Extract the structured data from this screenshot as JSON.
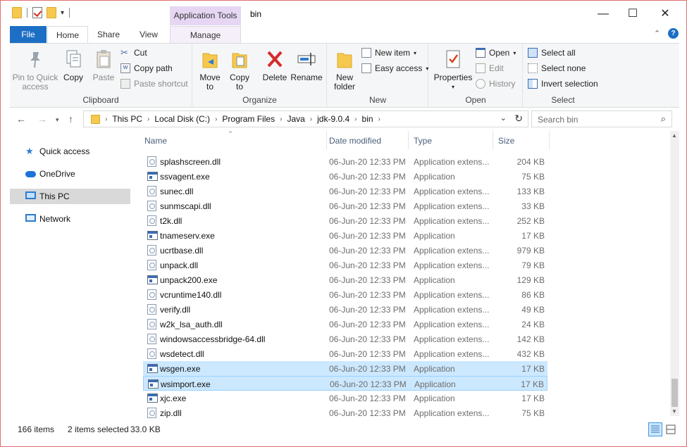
{
  "window": {
    "title": "bin",
    "context_tab_group": "Application Tools",
    "controls": {
      "minimize": "—",
      "maximize": "☐",
      "close": "✕"
    }
  },
  "ribbon_tabs": {
    "file": "File",
    "home": "Home",
    "share": "Share",
    "view": "View",
    "manage": "Manage"
  },
  "ribbon": {
    "clipboard": {
      "label": "Clipboard",
      "pin": "Pin to Quick access",
      "copy": "Copy",
      "paste": "Paste",
      "cut": "Cut",
      "copy_path": "Copy path",
      "paste_shortcut": "Paste shortcut"
    },
    "organize": {
      "label": "Organize",
      "move_to": "Move to",
      "copy_to": "Copy to",
      "delete": "Delete",
      "rename": "Rename"
    },
    "new": {
      "label": "New",
      "new_folder": "New folder",
      "new_item": "New item",
      "easy_access": "Easy access"
    },
    "open": {
      "label": "Open",
      "properties": "Properties",
      "open": "Open",
      "edit": "Edit",
      "history": "History"
    },
    "select": {
      "label": "Select",
      "select_all": "Select all",
      "select_none": "Select none",
      "invert_selection": "Invert selection"
    }
  },
  "address": {
    "crumbs": [
      "This PC",
      "Local Disk (C:)",
      "Program Files",
      "Java",
      "jdk-9.0.4",
      "bin"
    ],
    "search_placeholder": "Search bin"
  },
  "nav": {
    "items": [
      "Quick access",
      "OneDrive",
      "This PC",
      "Network"
    ]
  },
  "columns": {
    "name": "Name",
    "date": "Date modified",
    "type": "Type",
    "size": "Size"
  },
  "files": [
    {
      "name": "splashscreen.dll",
      "date": "06-Jun-20 12:33 PM",
      "type": "Application extens...",
      "size": "204 KB",
      "kind": "dll"
    },
    {
      "name": "ssvagent.exe",
      "date": "06-Jun-20 12:33 PM",
      "type": "Application",
      "size": "75 KB",
      "kind": "exe"
    },
    {
      "name": "sunec.dll",
      "date": "06-Jun-20 12:33 PM",
      "type": "Application extens...",
      "size": "133 KB",
      "kind": "dll"
    },
    {
      "name": "sunmscapi.dll",
      "date": "06-Jun-20 12:33 PM",
      "type": "Application extens...",
      "size": "33 KB",
      "kind": "dll"
    },
    {
      "name": "t2k.dll",
      "date": "06-Jun-20 12:33 PM",
      "type": "Application extens...",
      "size": "252 KB",
      "kind": "dll"
    },
    {
      "name": "tnameserv.exe",
      "date": "06-Jun-20 12:33 PM",
      "type": "Application",
      "size": "17 KB",
      "kind": "exe"
    },
    {
      "name": "ucrtbase.dll",
      "date": "06-Jun-20 12:33 PM",
      "type": "Application extens...",
      "size": "979 KB",
      "kind": "dll"
    },
    {
      "name": "unpack.dll",
      "date": "06-Jun-20 12:33 PM",
      "type": "Application extens...",
      "size": "79 KB",
      "kind": "dll"
    },
    {
      "name": "unpack200.exe",
      "date": "06-Jun-20 12:33 PM",
      "type": "Application",
      "size": "129 KB",
      "kind": "exe"
    },
    {
      "name": "vcruntime140.dll",
      "date": "06-Jun-20 12:33 PM",
      "type": "Application extens...",
      "size": "86 KB",
      "kind": "dll"
    },
    {
      "name": "verify.dll",
      "date": "06-Jun-20 12:33 PM",
      "type": "Application extens...",
      "size": "49 KB",
      "kind": "dll"
    },
    {
      "name": "w2k_lsa_auth.dll",
      "date": "06-Jun-20 12:33 PM",
      "type": "Application extens...",
      "size": "24 KB",
      "kind": "dll"
    },
    {
      "name": "windowsaccessbridge-64.dll",
      "date": "06-Jun-20 12:33 PM",
      "type": "Application extens...",
      "size": "142 KB",
      "kind": "dll"
    },
    {
      "name": "wsdetect.dll",
      "date": "06-Jun-20 12:33 PM",
      "type": "Application extens...",
      "size": "432 KB",
      "kind": "dll"
    },
    {
      "name": "wsgen.exe",
      "date": "06-Jun-20 12:33 PM",
      "type": "Application",
      "size": "17 KB",
      "kind": "exe",
      "selected": true
    },
    {
      "name": "wsimport.exe",
      "date": "06-Jun-20 12:33 PM",
      "type": "Application",
      "size": "17 KB",
      "kind": "exe",
      "selected": true,
      "focused": true
    },
    {
      "name": "xjc.exe",
      "date": "06-Jun-20 12:33 PM",
      "type": "Application",
      "size": "17 KB",
      "kind": "exe"
    },
    {
      "name": "zip.dll",
      "date": "06-Jun-20 12:33 PM",
      "type": "Application extens...",
      "size": "75 KB",
      "kind": "dll"
    }
  ],
  "status": {
    "item_count": "166 items",
    "selected": "2 items selected",
    "selected_size": "33.0 KB"
  },
  "colors": {
    "accent": "#1c6fc4",
    "selection": "#cce8ff",
    "context_tab": "#e6d6f3"
  }
}
